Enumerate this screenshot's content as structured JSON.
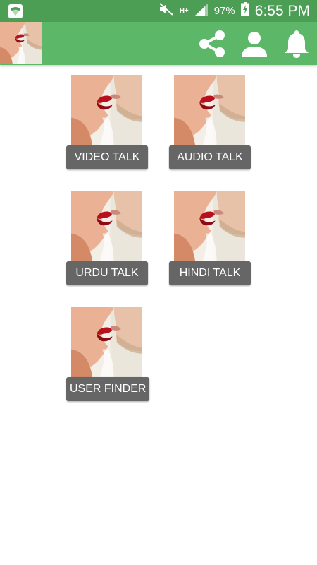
{
  "status_bar": {
    "network_type": "H+",
    "battery_percent": "97%",
    "time": "6:55 PM"
  },
  "app_bar": {
    "icons": [
      "app-logo",
      "share-icon",
      "person-icon",
      "bell-icon"
    ]
  },
  "tiles": [
    {
      "label": "VIDEO TALK"
    },
    {
      "label": "AUDIO TALK"
    },
    {
      "label": "URDU TALK"
    },
    {
      "label": "HINDI TALK"
    },
    {
      "label": "USER FINDER"
    }
  ],
  "colors": {
    "status_bar": "#4c9e55",
    "app_bar": "#5cb868",
    "button": "#666666"
  }
}
